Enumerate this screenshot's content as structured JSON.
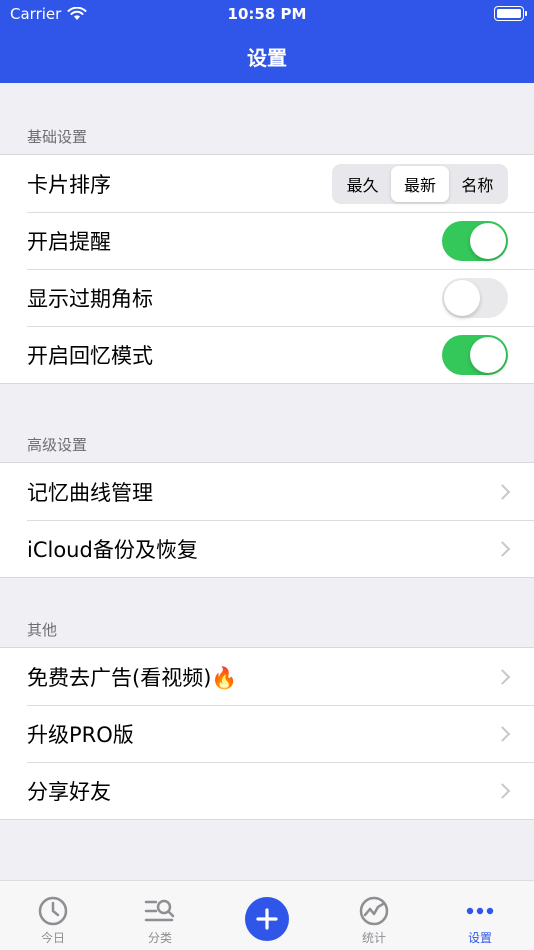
{
  "status_bar": {
    "carrier": "Carrier",
    "time": "10:58 PM"
  },
  "nav": {
    "title": "设置"
  },
  "sections": [
    {
      "header": "基础设置",
      "rows": [
        {
          "label": "卡片排序",
          "control": "segmented",
          "options": [
            "最久",
            "最新",
            "名称"
          ],
          "selected": "最新"
        },
        {
          "label": "开启提醒",
          "control": "toggle",
          "value": true
        },
        {
          "label": "显示过期角标",
          "control": "toggle",
          "value": false
        },
        {
          "label": "开启回忆模式",
          "control": "toggle",
          "value": true
        }
      ]
    },
    {
      "header": "高级设置",
      "rows": [
        {
          "label": "记忆曲线管理",
          "control": "chevron"
        },
        {
          "label": "iCloud备份及恢复",
          "control": "chevron"
        }
      ]
    },
    {
      "header": "其他",
      "rows": [
        {
          "label": "免费去广告(看视频)🔥",
          "control": "chevron"
        },
        {
          "label": "升级PRO版",
          "control": "chevron"
        },
        {
          "label": "分享好友",
          "control": "chevron"
        }
      ]
    }
  ],
  "tabbar": {
    "tabs": [
      {
        "label": "今日",
        "icon": "clock-icon"
      },
      {
        "label": "分类",
        "icon": "category-search-icon"
      },
      {
        "label": "",
        "icon": "plus-icon"
      },
      {
        "label": "统计",
        "icon": "trend-chart-icon"
      },
      {
        "label": "设置",
        "icon": "more-dots-icon",
        "active": true
      }
    ]
  },
  "colors": {
    "primary": "#2f56e8",
    "toggle_on": "#34c759",
    "toggle_off": "#e9e9eb",
    "background": "#efeff4"
  }
}
